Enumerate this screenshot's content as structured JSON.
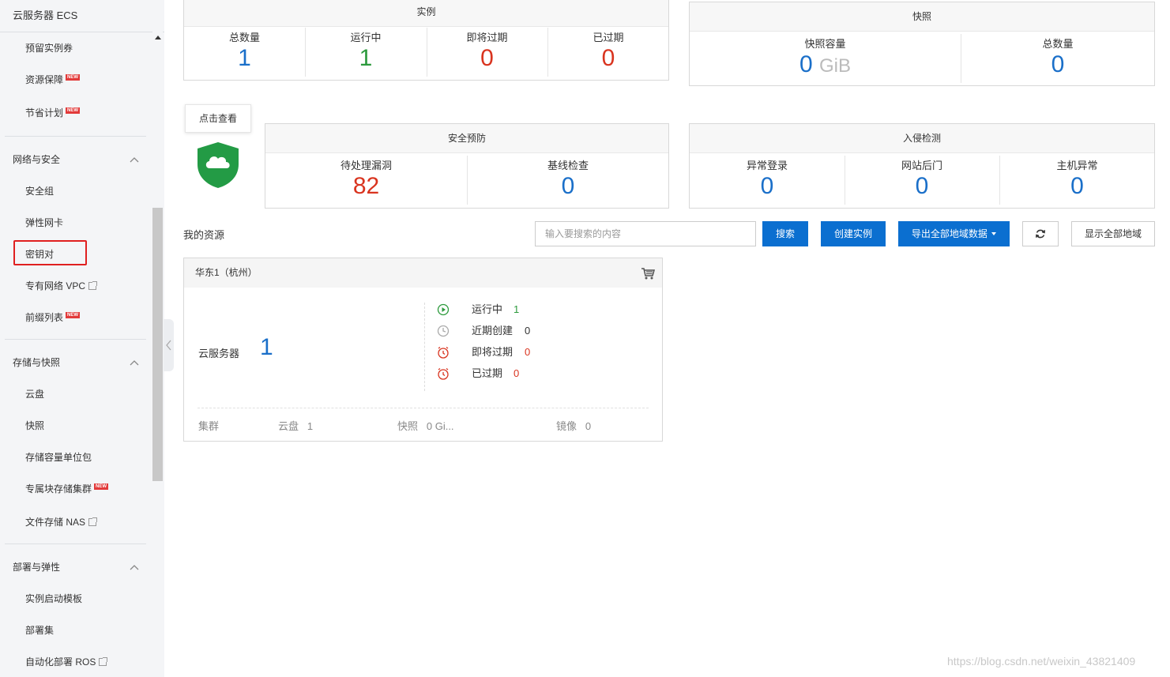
{
  "sidebar": {
    "title": "云服务器 ECS",
    "items_top": [
      {
        "label": "预留实例券",
        "new": false
      },
      {
        "label": "资源保障",
        "new": true
      },
      {
        "label": "节省计划",
        "new": true
      }
    ],
    "groups": [
      {
        "label": "网络与安全",
        "items": [
          {
            "label": "安全组",
            "new": false,
            "ext": false
          },
          {
            "label": "弹性网卡",
            "new": false,
            "ext": false
          },
          {
            "label": "密钥对",
            "new": false,
            "ext": false,
            "highlighted": true
          },
          {
            "label": "专有网络 VPC",
            "new": false,
            "ext": true
          },
          {
            "label": "前缀列表",
            "new": true,
            "ext": false
          }
        ]
      },
      {
        "label": "存储与快照",
        "items": [
          {
            "label": "云盘",
            "new": false,
            "ext": false
          },
          {
            "label": "快照",
            "new": false,
            "ext": false
          },
          {
            "label": "存储容量单位包",
            "new": false,
            "ext": false
          },
          {
            "label": "专属块存储集群",
            "new": true,
            "ext": false
          },
          {
            "label": "文件存储 NAS",
            "new": false,
            "ext": true
          }
        ]
      },
      {
        "label": "部署与弹性",
        "items": [
          {
            "label": "实例启动模板",
            "new": false,
            "ext": false
          },
          {
            "label": "部署集",
            "new": false,
            "ext": false
          },
          {
            "label": "自动化部署 ROS",
            "new": false,
            "ext": true
          }
        ]
      }
    ],
    "new_badge": "NEW"
  },
  "instances": {
    "title": "实例",
    "cells": [
      {
        "label": "总数量",
        "value": "1"
      },
      {
        "label": "运行中",
        "value": "1"
      },
      {
        "label": "即将过期",
        "value": "0"
      },
      {
        "label": "已过期",
        "value": "0"
      }
    ]
  },
  "snapshots": {
    "title": "快照",
    "capacity_label": "快照容量",
    "capacity_value": "0",
    "capacity_unit": "GiB",
    "total_label": "总数量",
    "total_value": "0"
  },
  "tooltip": "点击查看",
  "security": {
    "title": "安全预防",
    "vuln_label": "待处理漏洞",
    "vuln_value": "82",
    "baseline_label": "基线检查",
    "baseline_value": "0"
  },
  "intrusion": {
    "title": "入侵检测",
    "cells": [
      {
        "label": "异常登录",
        "value": "0"
      },
      {
        "label": "网站后门",
        "value": "0"
      },
      {
        "label": "主机异常",
        "value": "0"
      }
    ]
  },
  "resources": {
    "title": "我的资源",
    "search_placeholder": "输入要搜索的内容",
    "search_button": "搜索",
    "create_button": "创建实例",
    "export_button": "导出全部地域数据",
    "show_all_button": "显示全部地域"
  },
  "region": {
    "name": "华东1（杭州）",
    "server_label": "云服务器",
    "server_count": "1",
    "stats": [
      {
        "label": "运行中",
        "value": "1",
        "color": "#2c9a3c"
      },
      {
        "label": "近期创建",
        "value": "0",
        "color": "#333333"
      },
      {
        "label": "即将过期",
        "value": "0",
        "color": "#d9341f"
      },
      {
        "label": "已过期",
        "value": "0",
        "color": "#d9341f"
      }
    ],
    "footer": {
      "cluster_label": "集群",
      "disk_label": "云盘",
      "disk_value": "1",
      "snapshot_label": "快照",
      "snapshot_value": "0 Gi...",
      "image_label": "镜像",
      "image_value": "0"
    }
  },
  "watermark": "https://blog.csdn.net/weixin_43821409"
}
